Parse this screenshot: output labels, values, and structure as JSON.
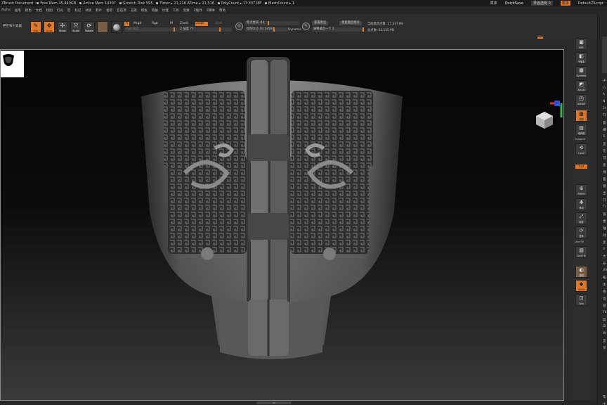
{
  "titlebar": {
    "doc": "ZBrush Document",
    "free_mem": "Free Mem 45.443GB",
    "active_mem": "Active Mem 14307",
    "scratch": "Scratch Disk 595",
    "timer": "Timer ▸ 21.216 ATime ▸ 21.516",
    "polycount": "PolyCount ▸ 17.337 MP",
    "meshcount": "MeshCount ▸ 1",
    "menus": "菜单",
    "quicksave": "QuickSave",
    "alpha": "界面透明 0",
    "menu_btn": "菜单",
    "default_script": "DefaultZScript"
  },
  "menubar": [
    "Alpha",
    "画笔",
    "颜色",
    "文档",
    "绘图",
    "灯光",
    "宏",
    "标记",
    "材质",
    "影片",
    "拾取",
    "首选项",
    "渲染",
    "模板",
    "笔触",
    "纹理",
    "工具",
    "变换",
    "Z插件",
    "Z脚本",
    "帮助"
  ],
  "toolbar": {
    "home_label": "把至布尔滤器",
    "buttons": [
      {
        "glyph": "✎",
        "label": "Edit",
        "active": true
      },
      {
        "glyph": "✥",
        "label": "Draw",
        "active": true
      },
      {
        "glyph": "✢",
        "label": "Move",
        "active": false
      },
      {
        "glyph": "⤧",
        "label": "Scale",
        "active": false
      },
      {
        "glyph": "⟳",
        "label": "Rotate",
        "active": false
      }
    ],
    "mrgb": "A",
    "rgb_m": "Mrgb",
    "rgb": "Rgb",
    "m": "M",
    "rgb_intensity": "Rgb 强度",
    "zadd": "Zadd",
    "zsub": "Zsub",
    "zcut": "Zcut",
    "z_intensity": "Z 强度 77",
    "focal_shift": "焦点衰减 -14",
    "draw_size": "绘制大小 10.53594",
    "dynamic": "Dynamic",
    "active_points": "当前激活点数: 17.337 Mil",
    "total_points": "总点数: 63.555 Mil",
    "reset_pivot": "重置重启",
    "undo_last": "重复最后相对",
    "adjust_last": "调整最后一个 1"
  },
  "right_shelf": [
    {
      "glyph": "▣",
      "label": "BPR"
    },
    {
      "glyph": "◧",
      "label": "子像素"
    },
    {
      "glyph": "▦",
      "label": "Dynamic"
    },
    {
      "glyph": "◩",
      "label": "Actual"
    },
    {
      "glyph": "◰",
      "label": "AAHalf"
    },
    {
      "glyph": "▩",
      "label": "透视"
    },
    {
      "glyph": "▤",
      "label": "地网格"
    },
    {
      "glyph": "⊞",
      "label": "Xyz"
    },
    {
      "glyph": "⟲",
      "label": "Local"
    },
    {
      "glyph": "⊕",
      "label": "Frame"
    },
    {
      "glyph": "✥",
      "label": "移动"
    },
    {
      "glyph": "⤢",
      "label": "缩放"
    },
    {
      "glyph": "⟳",
      "label": "旋转"
    },
    {
      "glyph": "▥",
      "label": "Line Fill"
    },
    {
      "glyph": "◐",
      "label": "透明"
    },
    {
      "glyph": "◆",
      "label": "Ghost"
    },
    {
      "glyph": "⊡",
      "label": "Solo"
    }
  ],
  "right_shelf_labels": {
    "dynamic": "Dynamic",
    "xyz_orange": "Xyz",
    "line_fill": "Line Fill"
  },
  "right_panel": [
    "子",
    "八",
    "A",
    "N",
    "2(",
    "T(",
    "面",
    "细",
    "Fi",
    "显",
    "元",
    "可",
    "变",
    "线",
    "面",
    "接",
    "坐",
    "刀",
    "Ti",
    "旋",
    "更",
    "轴",
    "对",
    "变",
    "3",
    "大",
    "形",
    "UV",
    "拓",
    "主",
    "管",
    "位",
    "层",
    "Fb",
    "复",
    "Z(",
    "W",
    "显",
    "单",
    "布",
    "主"
  ],
  "bottom": {
    "handle": "▴▾"
  },
  "colors": {
    "accent": "#e0782b",
    "bg": "#2a2a2a",
    "viewport_bg": "#0a0a0a"
  }
}
